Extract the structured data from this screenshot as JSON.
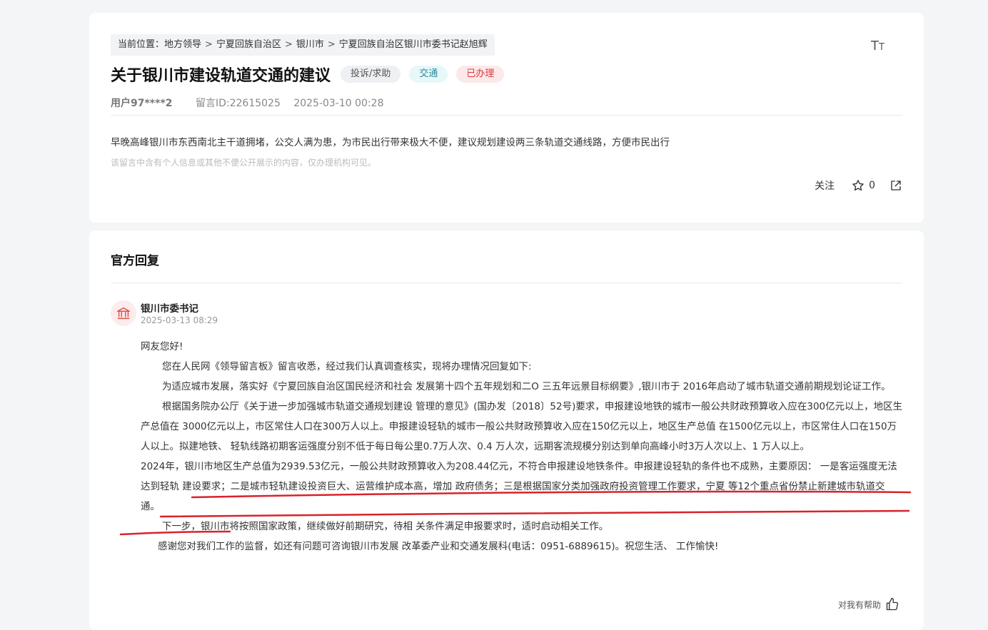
{
  "breadcrumb": {
    "prefix": "当前位置：",
    "items": [
      "地方领导",
      "宁夏回族自治区",
      "银川市",
      "宁夏回族自治区银川市委书记赵旭辉"
    ],
    "separator": ">"
  },
  "font_toggle": {
    "label_big": "T",
    "label_small": "T"
  },
  "question": {
    "title": "关于银川市建设轨道交通的建议",
    "tags": [
      {
        "label": "投诉/求助",
        "style": "grey"
      },
      {
        "label": "交通",
        "style": "cyan"
      },
      {
        "label": "已办理",
        "style": "red"
      }
    ],
    "user": "用户97****2",
    "message_id": "留言ID:22615025",
    "time": "2025-03-10 00:28",
    "content": "早晚高峰银川市东西南北主干道拥堵，公交人满为患，为市民出行带来极大不便，建议规划建设两三条轨道交通线路，方便市民出行",
    "privacy_note": "该留言中含有个人信息或其他不便公开展示的内容，仅办理机构可见。"
  },
  "actions": {
    "follow": "关注",
    "star_count": "0"
  },
  "reply": {
    "heading": "官方回复",
    "replier": "银川市委书记",
    "time": "2025-03-13 08:29",
    "greeting": "网友您好!",
    "para1": "您在人民网《领导留言板》留言收悉，经过我们认真调查核实，现将办理情况回复如下:",
    "para2": "为适应城市发展，落实好《宁夏回族自治区国民经济和社会 发展第十四个五年规划和二O 三五年远景目标纲要》,银川市于 2016年启动了城市轨道交通前期规划论证工作。",
    "para3": "根据国务院办公厅《关于进一步加强城市轨道交通规划建设 管理的意见》(国办发〔2018〕52号)要求，申报建设地铁的城市一般公共财政预算收入应在300亿元以上，地区生产总值在 3000亿元以上，市区常住人口在300万人以上。申报建设轻轨的城市一般公共财政预算收入应在150亿元以上，地区生产总值 在1500亿元以上，市区常住人口在150万人以上。拟建地铁、 轻轨线路初期客运强度分别不低于每日每公里0.7万人次、0.4 万人次，远期客流规模分别达到单向高峰小时3万人次以上、1 万人以上。",
    "para4": "2024年，银川市地区生产总值为2939.53亿元，一般公共财政预算收入为208.44亿元，不符合申报建设地铁条件。申报建设轻轨的条件也不成熟，主要原因：  一是客运强度无法达到轻轨 建设要求；二是城市轻轨建设投资巨大、运营维护成本高，增加 政府债务；三是根据国家分类加强政府投资管理工作要求，宁夏 等12个重点省份禁止新建城市轨道交通。",
    "para5": "下一步，银川市将按照国家政策，继续做好前期研究，待相 关条件满足申报要求时，适时启动相关工作。",
    "para6": "感谢您对我们工作的监督，如还有问题可咨询银川市发展 改革委产业和交通发展科(电话：0951-6889615)。祝您生活、 工作愉快!",
    "helpful": "对我有帮助"
  },
  "colors": {
    "tag_red": "#d53a3a",
    "tag_cyan": "#2a8a9a",
    "annotation_red": "#d8232a"
  }
}
